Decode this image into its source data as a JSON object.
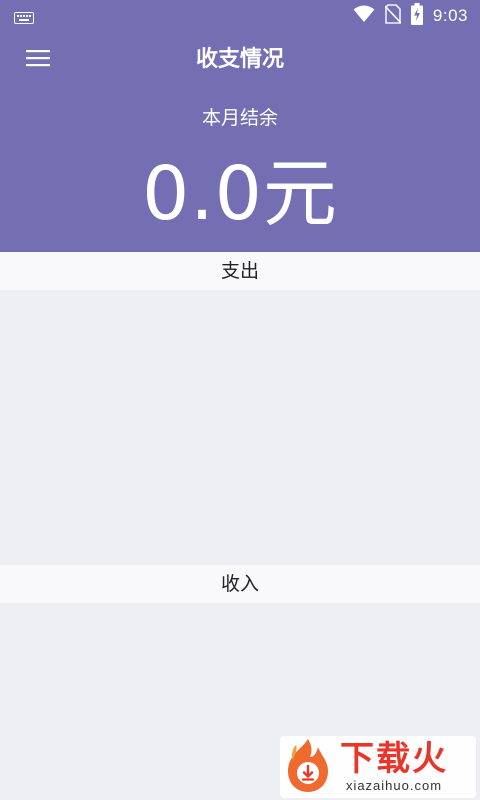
{
  "status_bar": {
    "time": "9:03",
    "icons": [
      "keyboard-icon",
      "wifi-icon",
      "no-sim-icon",
      "battery-charging-icon"
    ]
  },
  "header": {
    "menu_icon": "hamburger-menu-icon",
    "title": "收支情况",
    "balance_label": "本月结余",
    "balance_amount": "0.0元"
  },
  "sections": {
    "expense": {
      "label": "支出"
    },
    "income": {
      "label": "收入"
    }
  },
  "watermark": {
    "brand": "下载火",
    "domain": "xiazaihuo.com"
  },
  "colors": {
    "primary": "#736fb2",
    "background": "#eeeff5",
    "section_header": "#f9f9fb",
    "watermark_red": "#e8362b"
  }
}
